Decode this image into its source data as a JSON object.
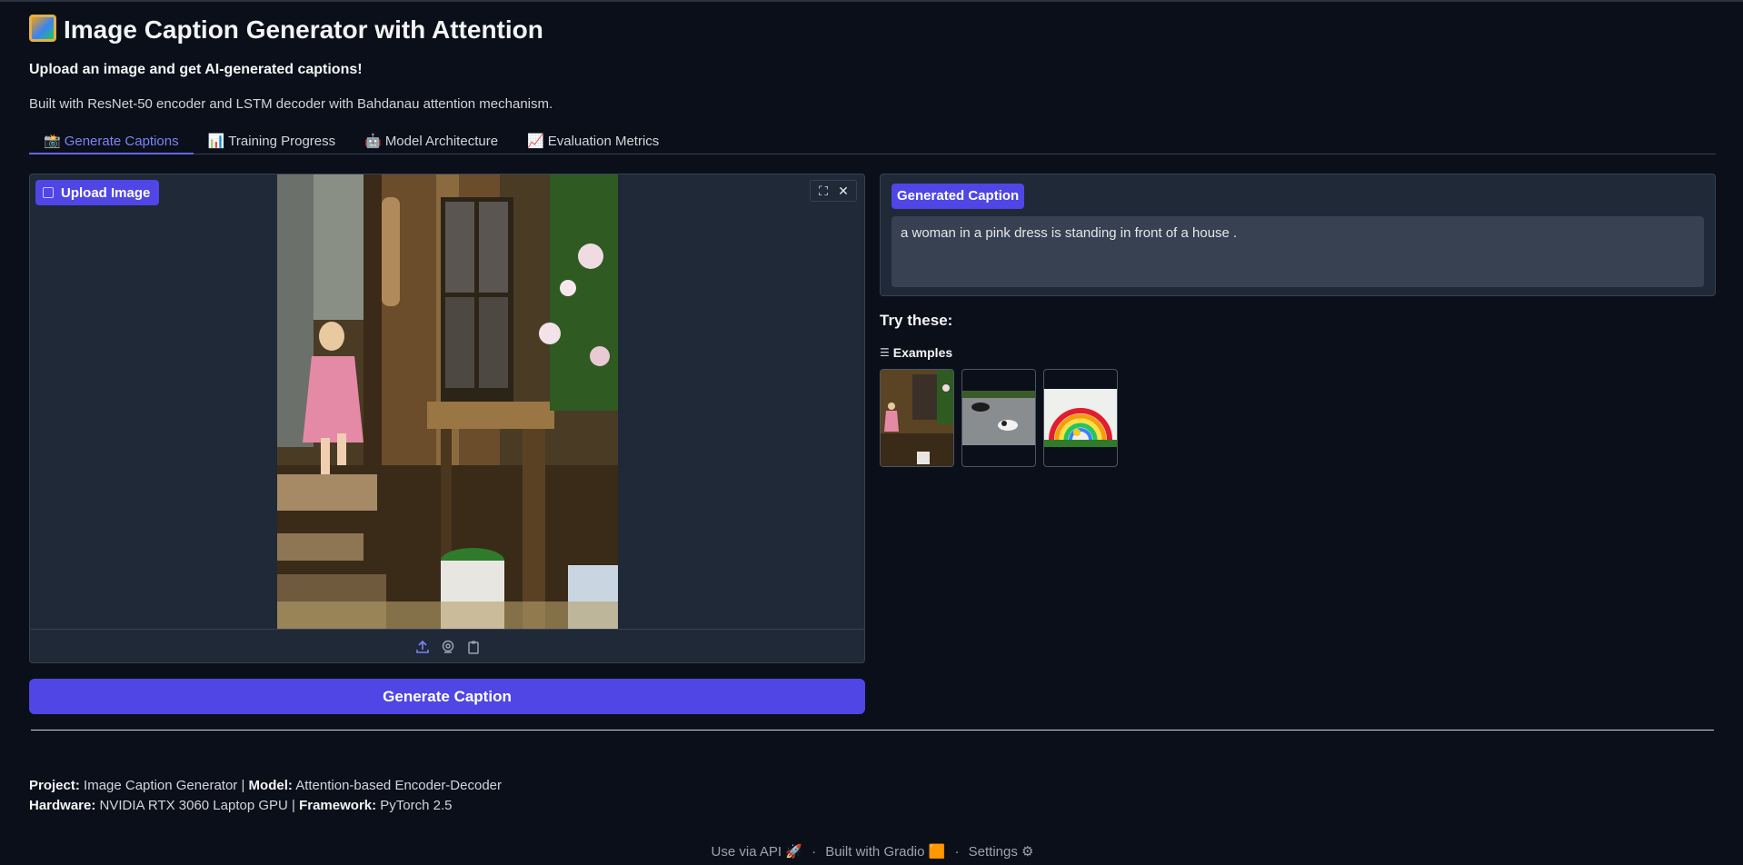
{
  "app": {
    "title": "Image Caption Generator with Attention",
    "subtitle": "Upload an image and get AI-generated captions!",
    "description": "Built with ResNet-50 encoder and LSTM decoder with Bahdanau attention mechanism."
  },
  "tabs": [
    {
      "icon": "📸",
      "label": "Generate Captions",
      "active": true
    },
    {
      "icon": "📊",
      "label": "Training Progress",
      "active": false
    },
    {
      "icon": "🤖",
      "label": "Model Architecture",
      "active": false
    },
    {
      "icon": "📈",
      "label": "Evaluation Metrics",
      "active": false
    }
  ],
  "upload": {
    "label": "Upload Image",
    "image_subject": "toddler in pink dress climbing steps of a wooden house",
    "source_icons": [
      "upload-icon",
      "webcam-icon",
      "clipboard-icon"
    ]
  },
  "generate_button": "Generate Caption",
  "caption": {
    "label": "Generated Caption",
    "text": "a woman in a pink dress is standing in front of a house ."
  },
  "examples": {
    "heading": "Try these:",
    "label": "Examples"
  },
  "footer": {
    "project_key": "Project:",
    "project_value": " Image Caption Generator | ",
    "model_key": "Model:",
    "model_value": " Attention-based Encoder-Decoder",
    "hardware_key": "Hardware:",
    "hardware_value": " NVIDIA RTX 3060 Laptop GPU | ",
    "framework_key": "Framework:",
    "framework_value": " PyTorch 2.5"
  },
  "bottom_links": {
    "api": "Use via API 🚀",
    "gradio": "Built with Gradio 🟧",
    "settings": "Settings ⚙"
  },
  "colors": {
    "background": "#0b0f19",
    "panel": "#1f2937",
    "accent": "#4f46e5",
    "active_tab": "#7c83f5"
  }
}
